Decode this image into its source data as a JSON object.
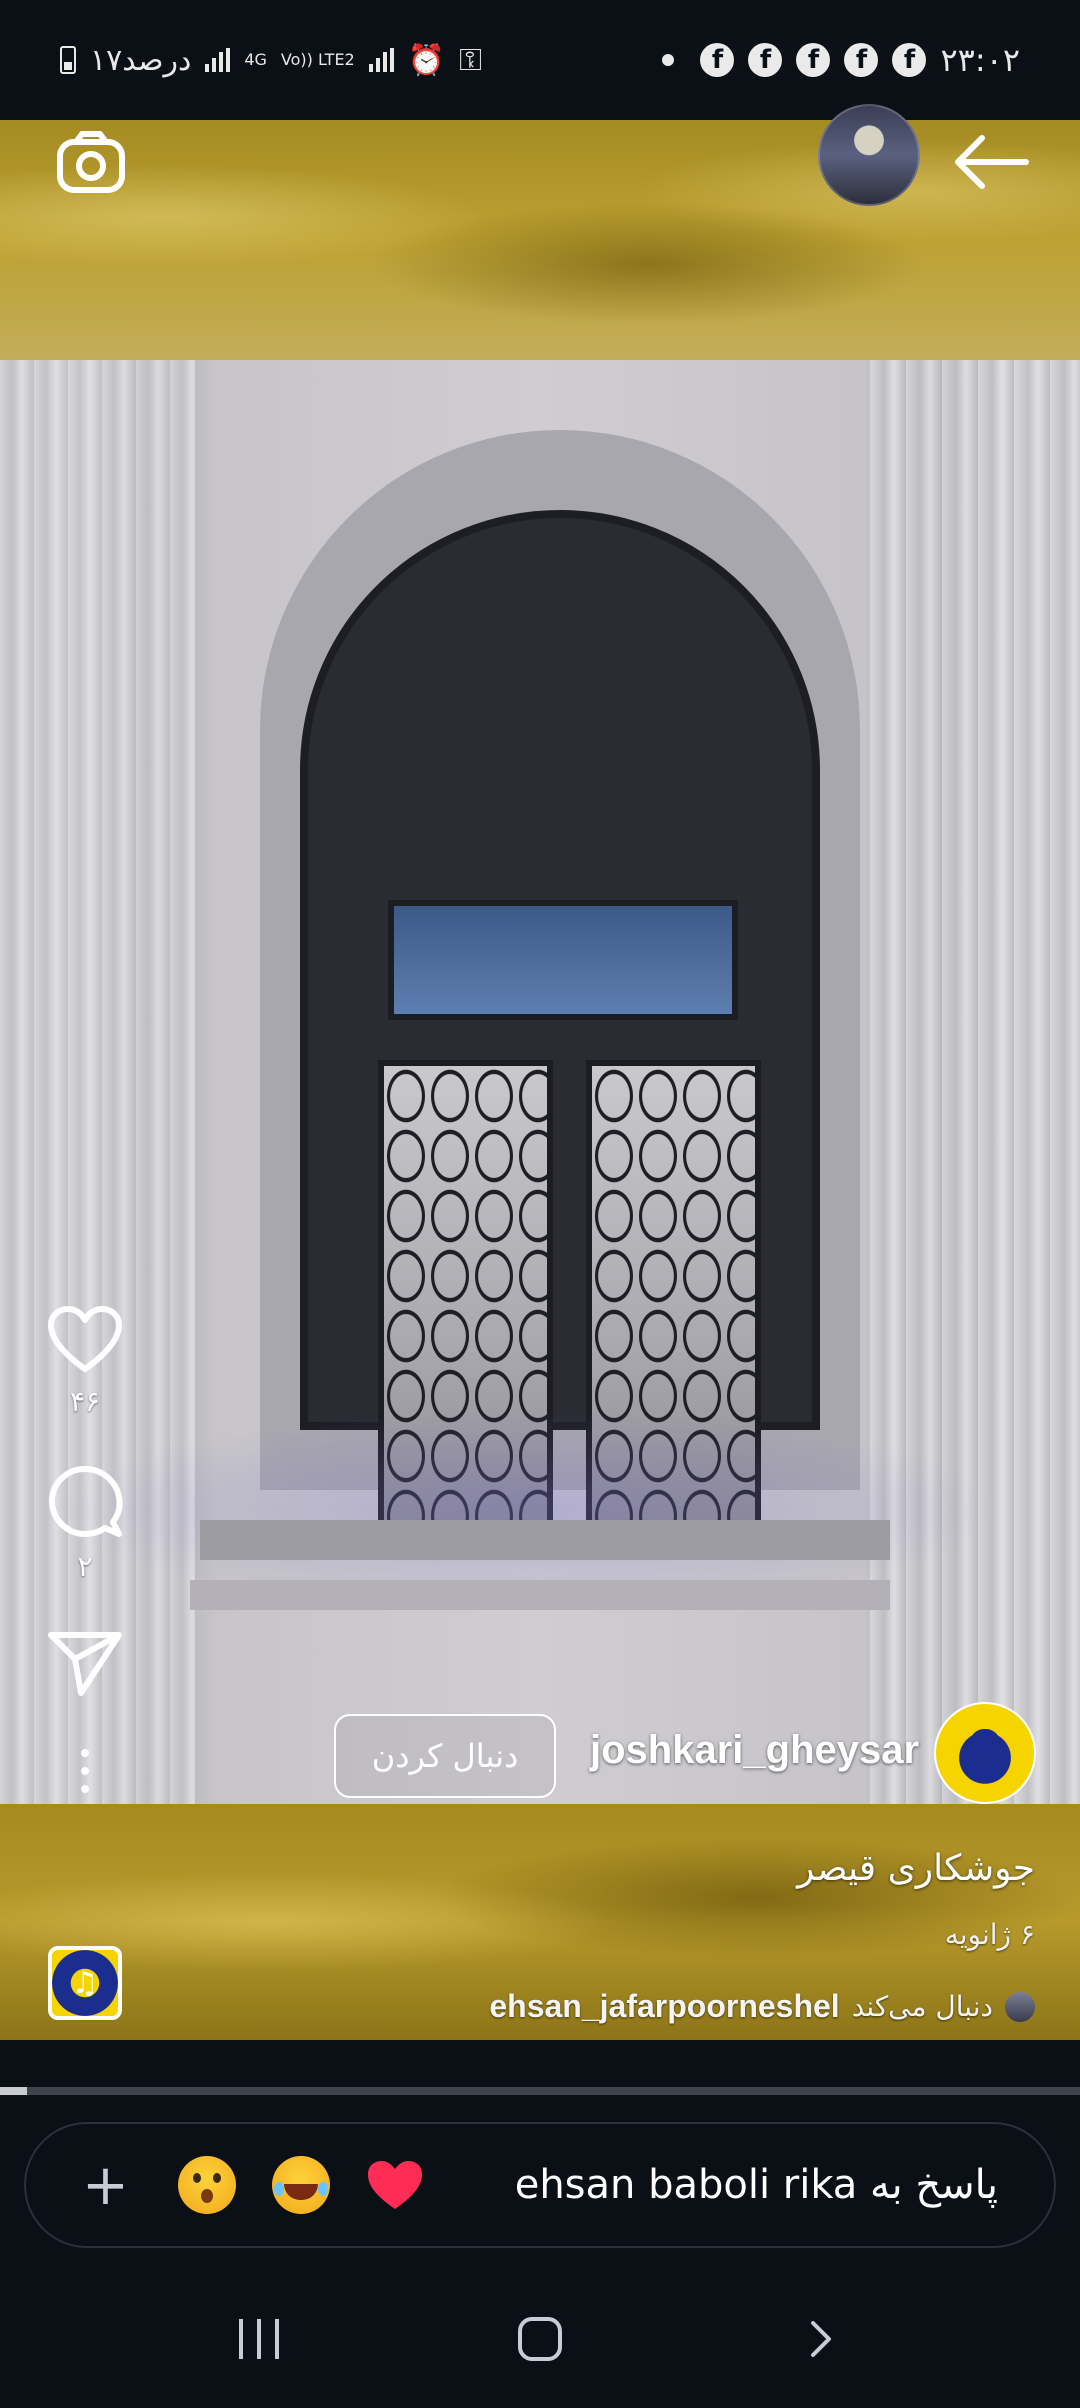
{
  "status_bar": {
    "time": "۲۳:۰۲",
    "battery_text": "۱۷درصد",
    "network_4g": "4G",
    "network_lte": "Vo)) LTE2",
    "notification_icons": [
      "facebook-icon",
      "facebook-icon",
      "facebook-icon",
      "facebook-icon",
      "facebook-icon"
    ]
  },
  "post": {
    "username": "joshkari_gheysar",
    "follow_label": "دنبال کردن",
    "caption": "جوشکاری قیصر",
    "date": "۶ ژانویه",
    "followed_by_user": "ehsan_jafarpoorneshel",
    "followed_by_text": "دنبال می‌کند",
    "likes": "۴۶",
    "comments": "۲",
    "progress": 0.025
  },
  "reply": {
    "placeholder": "پاسخ به ehsan baboli rika",
    "plus": "+"
  },
  "icons": {
    "camera": "camera-icon",
    "back": "back-arrow-icon",
    "like": "heart-icon",
    "comment": "comment-icon",
    "share": "send-icon",
    "more": "more-icon"
  }
}
